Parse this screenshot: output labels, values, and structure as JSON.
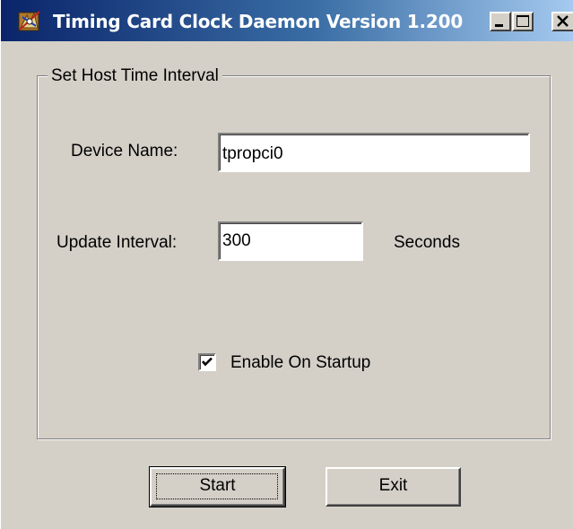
{
  "window": {
    "title": "Timing Card Clock Daemon Version 1.200",
    "icon": "app-clock-icon",
    "caption_buttons": [
      "minimize-icon",
      "maximize-icon",
      "close-icon"
    ]
  },
  "group": {
    "legend": "Set Host Time Interval"
  },
  "fields": {
    "device_label": "Device Name:",
    "device_value": "tpropci0",
    "interval_label": "Update Interval:",
    "interval_value": "300",
    "interval_unit": "Seconds"
  },
  "options": {
    "enable_label": "Enable On Startup",
    "enable_checked": true
  },
  "buttons": {
    "start_label": "Start",
    "exit_label": "Exit"
  },
  "colors": {
    "face": "#d4d0c8",
    "titlebar_start": "#0a246a",
    "titlebar_end": "#a6caf0"
  }
}
